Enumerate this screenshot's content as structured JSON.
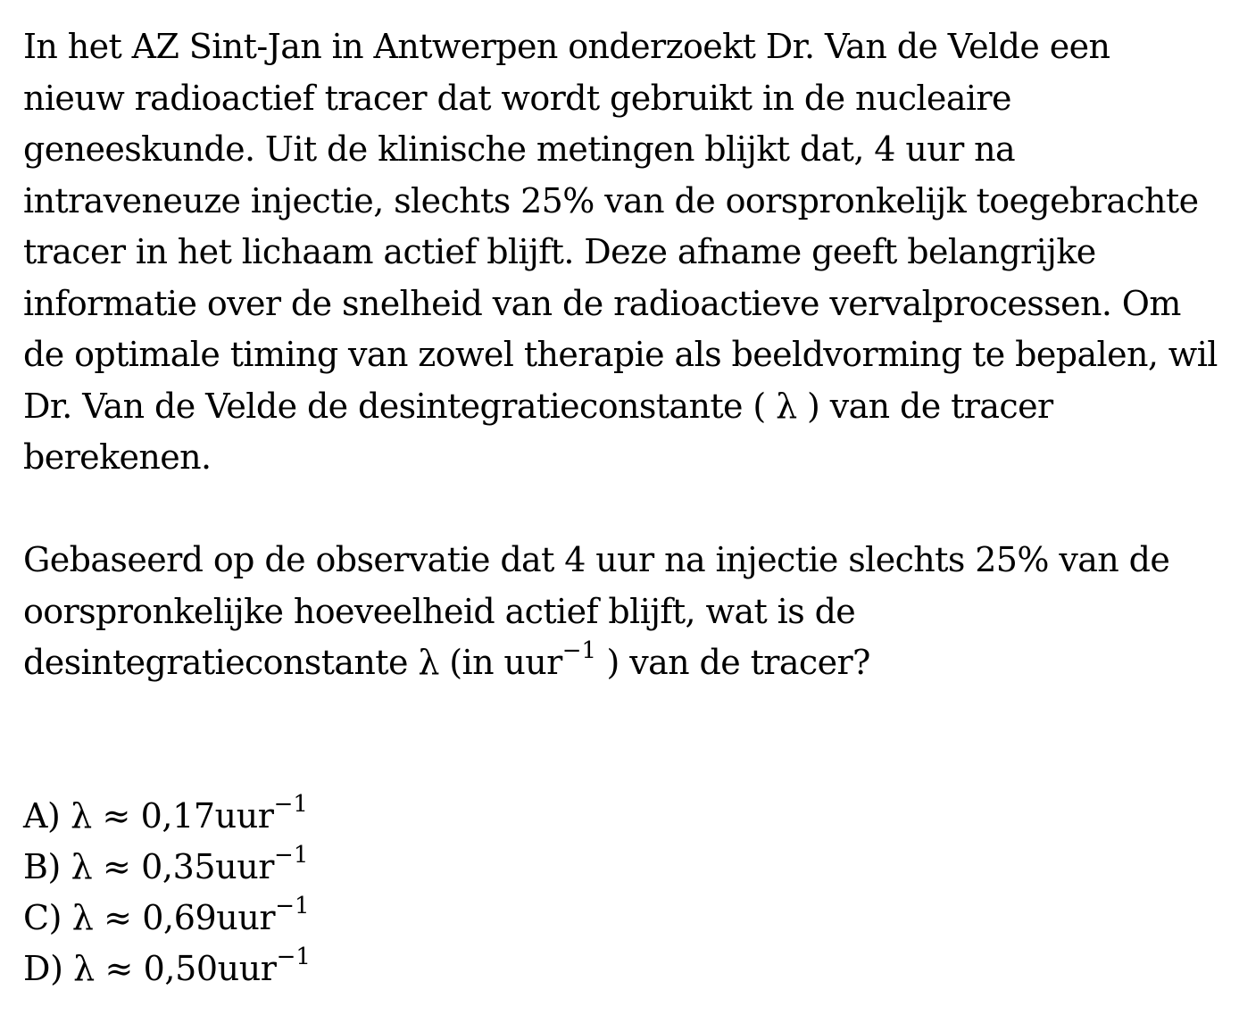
{
  "intro_paragraph": "In het AZ Sint-Jan in Antwerpen onderzoekt Dr. Van de Velde een nieuw radioactief tracer dat wordt gebruikt in de nucleaire geneeskunde. Uit de klinische metingen blijkt dat, 4 uur na intraveneuze injectie, slechts 25% van de oorspronkelijk toegebrachte tracer in het lichaam actief blijft. Deze afname geeft belangrijke informatie over de snelheid van de radioactieve vervalprocessen. Om de optimale timing van zowel therapie als beeldvorming te bepalen, wil Dr. Van de Velde de desintegratieconstante ( λ ) van de tracer berekenen.",
  "question": {
    "text_before": "Gebaseerd op de observatie dat 4 uur na injectie slechts 25% van de oorspronkelijke hoeveelheid actief blijft, wat is de desintegratieconstante λ (in uur",
    "exponent": "−1",
    "text_after": " ) van de tracer?"
  },
  "options": [
    {
      "prefix": "A) λ ≈ 0,17uur",
      "exponent": "−1"
    },
    {
      "prefix": "B) λ ≈ 0,35uur",
      "exponent": "−1"
    },
    {
      "prefix": "C) λ ≈ 0,69uur",
      "exponent": "−1"
    },
    {
      "prefix": "D) λ ≈ 0,50uur",
      "exponent": "−1"
    }
  ]
}
